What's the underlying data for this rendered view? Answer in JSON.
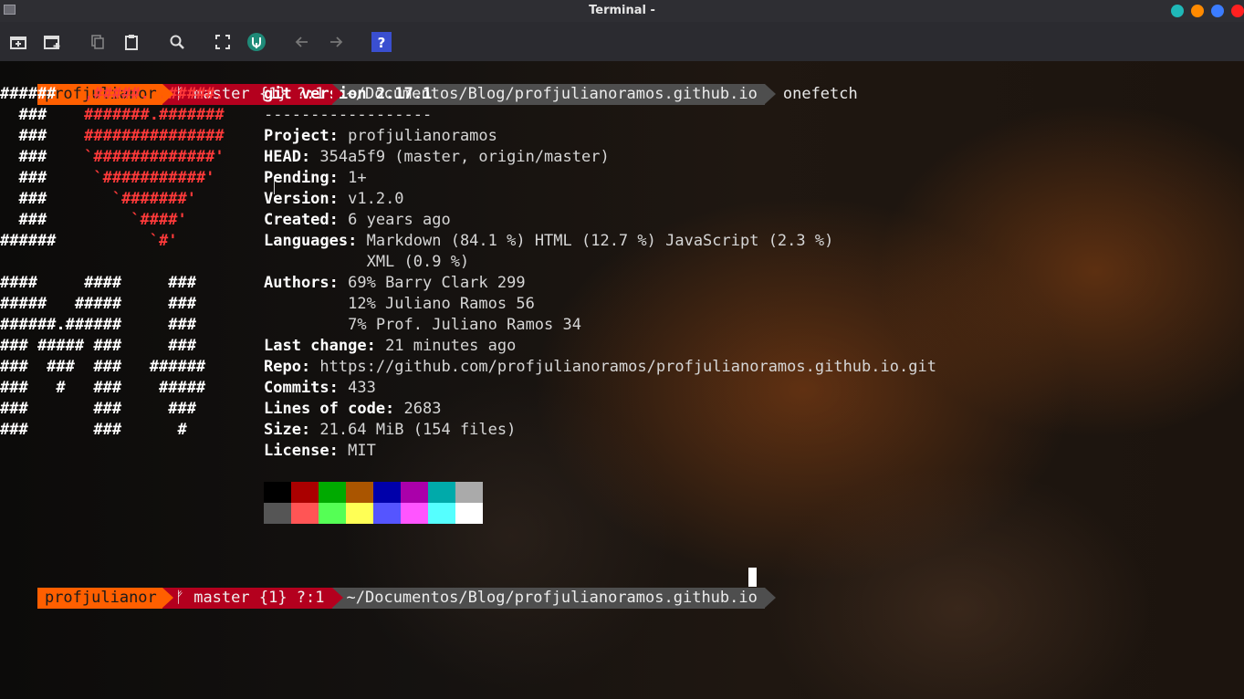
{
  "window": {
    "title": "Terminal -",
    "buttons": [
      "#1fb8b8",
      "#ff8a00",
      "#3b7cff",
      "#ff2020"
    ]
  },
  "toolbar": {
    "icons": [
      "new-tab-icon",
      "new-window-icon",
      "copy-icon",
      "paste-icon",
      "search-icon",
      "fullscreen-icon",
      "logo-icon",
      "back-icon",
      "forward-icon",
      "help-icon"
    ]
  },
  "prompt1": {
    "user": "profjulianor",
    "git": "ᚠ master {1} ?:1",
    "path": "~/Documentos/Blog/profjulianoramos.github.io",
    "command": "onefetch"
  },
  "prompt2": {
    "user": "profjulianor",
    "git": "ᚠ master {1} ?:1",
    "path": "~/Documentos/Blog/profjulianoramos.github.io"
  },
  "logo_lines": [
    [
      [
        "######   ",
        "w"
      ],
      [
        ",#####. .#####.",
        "r"
      ]
    ],
    [
      [
        "  ###    ",
        "w"
      ],
      [
        "#######.#######",
        "r"
      ]
    ],
    [
      [
        "  ###    ",
        "w"
      ],
      [
        "###############",
        "r"
      ]
    ],
    [
      [
        "  ###    ",
        "w"
      ],
      [
        "`#############'",
        "r"
      ]
    ],
    [
      [
        "  ###    ",
        "w"
      ],
      [
        " `###########'",
        "r"
      ]
    ],
    [
      [
        "  ###    ",
        "w"
      ],
      [
        "   `#######'",
        "r"
      ]
    ],
    [
      [
        "  ###    ",
        "w"
      ],
      [
        "     `####'",
        "r"
      ]
    ],
    [
      [
        "######   ",
        "w"
      ],
      [
        "       `#'",
        "r"
      ]
    ],
    [
      [
        "",
        "w"
      ]
    ],
    [
      [
        "####     ####     ###",
        "w"
      ]
    ],
    [
      [
        "#####   #####     ###",
        "w"
      ]
    ],
    [
      [
        "######.######     ###",
        "w"
      ]
    ],
    [
      [
        "### ##### ###     ###",
        "w"
      ]
    ],
    [
      [
        "###  ###  ###   ######",
        "w"
      ]
    ],
    [
      [
        "###   #   ###    #####",
        "w"
      ]
    ],
    [
      [
        "###       ###     ###",
        "w"
      ]
    ],
    [
      [
        "###       ###      #",
        "w"
      ]
    ]
  ],
  "info": {
    "header": "git version 2.17.1",
    "separator": "------------------",
    "rows": [
      {
        "label": "Project:",
        "value": " profjulianoramos"
      },
      {
        "label": "HEAD:",
        "value": " 354a5f9 (master, origin/master)"
      },
      {
        "label": "Pending:",
        "value": " 1+"
      },
      {
        "label": "Version:",
        "value": " v1.2.0"
      },
      {
        "label": "Created:",
        "value": " 6 years ago"
      },
      {
        "label": "Languages:",
        "value": " Markdown (84.1 %) HTML (12.7 %) JavaScript (2.3 %)"
      },
      {
        "label": "",
        "value": "           XML (0.9 %)"
      },
      {
        "label": "Authors:",
        "value": " 69% Barry Clark 299"
      },
      {
        "label": "",
        "value": "         12% Juliano Ramos 56"
      },
      {
        "label": "",
        "value": "         7% Prof. Juliano Ramos 34"
      },
      {
        "label": "Last change:",
        "value": " 21 minutes ago"
      },
      {
        "label": "Repo:",
        "value": " https://github.com/profjulianoramos/profjulianoramos.github.io.git"
      },
      {
        "label": "Commits:",
        "value": " 433"
      },
      {
        "label": "Lines of code:",
        "value": " 2683"
      },
      {
        "label": "Size:",
        "value": " 21.64 MiB (154 files)"
      },
      {
        "label": "License:",
        "value": " MIT"
      }
    ]
  },
  "palette": {
    "normal": [
      "#000000",
      "#aa0000",
      "#00aa00",
      "#aa5500",
      "#0000aa",
      "#aa00aa",
      "#00aaaa",
      "#aaaaaa"
    ],
    "bright": [
      "#555555",
      "#ff5555",
      "#55ff55",
      "#ffff55",
      "#5555ff",
      "#ff55ff",
      "#55ffff",
      "#ffffff"
    ]
  }
}
